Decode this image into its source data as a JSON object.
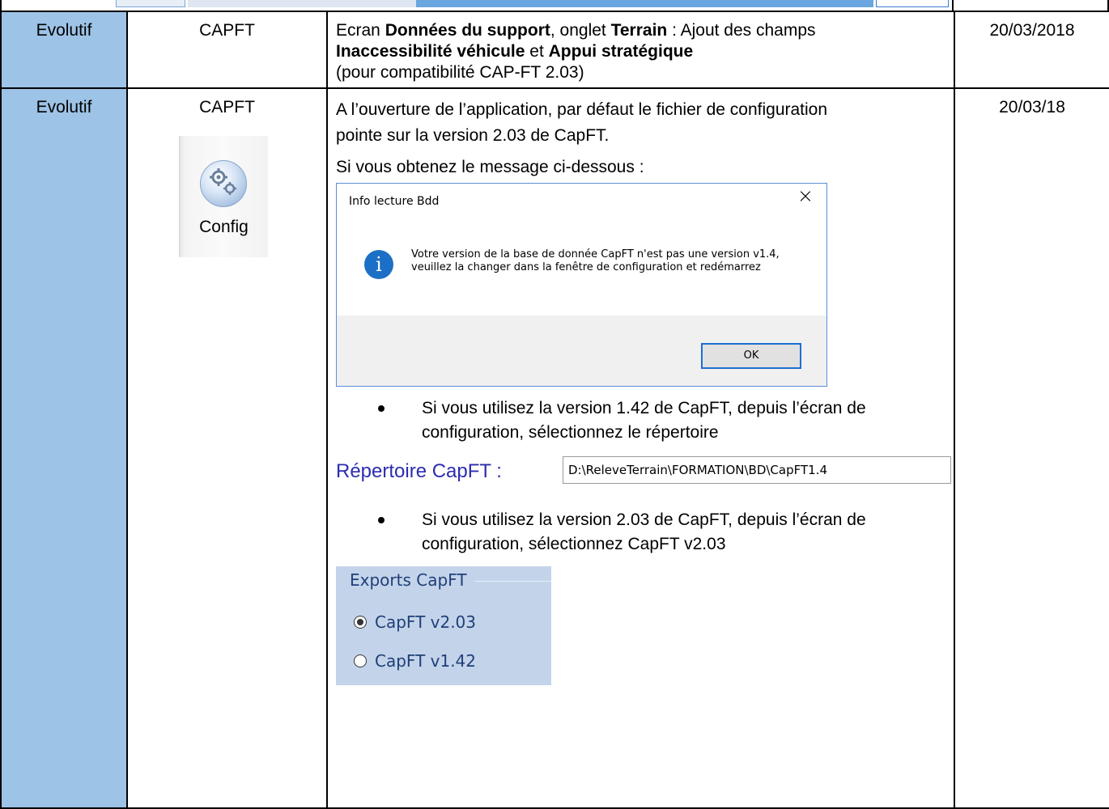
{
  "rows": [
    {
      "type": "Evolutif",
      "app": "CAPFT",
      "desc_parts": [
        "Ecran ",
        "Données du support",
        ", onglet ",
        "Terrain",
        " : Ajout des champs ",
        "Inaccessibilité véhicule",
        " et ",
        "Appui stratégique",
        "(pour compatibilité CAP-FT 2.03)"
      ],
      "date": "20/03/2018"
    },
    {
      "type": "Evolutif",
      "app": "CAPFT",
      "date": "20/03/18",
      "config_label": "Config",
      "intro": "A l’ouverture de l’application, par défaut le fichier de configuration pointe sur la version 2.03 de CapFT.",
      "message_intro": "Si vous obtenez le message ci-dessous :",
      "dialog": {
        "title": "Info lecture Bdd",
        "close": "×",
        "info_glyph": "i",
        "message": "Votre version de la base de donnée CapFT n'est pas une version v1.4, veuillez la changer dans la fenêtre de configuration et redémarrez",
        "ok": "OK"
      },
      "bullet1": "Si vous utilisez la version 1.42 de CapFT, depuis l’écran de configuration, sélectionnez le répertoire",
      "repertoire_label": "Répertoire CapFT :",
      "repertoire_value": "D:\\ReleveTerrain\\FORMATION\\BD\\CapFT1.4",
      "bullet2": "Si vous utilisez la version 2.03 de CapFT, depuis l’écran de configuration, sélectionnez CapFT v2.03",
      "exports": {
        "legend": "Exports CapFT",
        "options": [
          {
            "label": "CapFT v2.03",
            "selected": true
          },
          {
            "label": "CapFT v1.42",
            "selected": false
          }
        ]
      }
    }
  ]
}
